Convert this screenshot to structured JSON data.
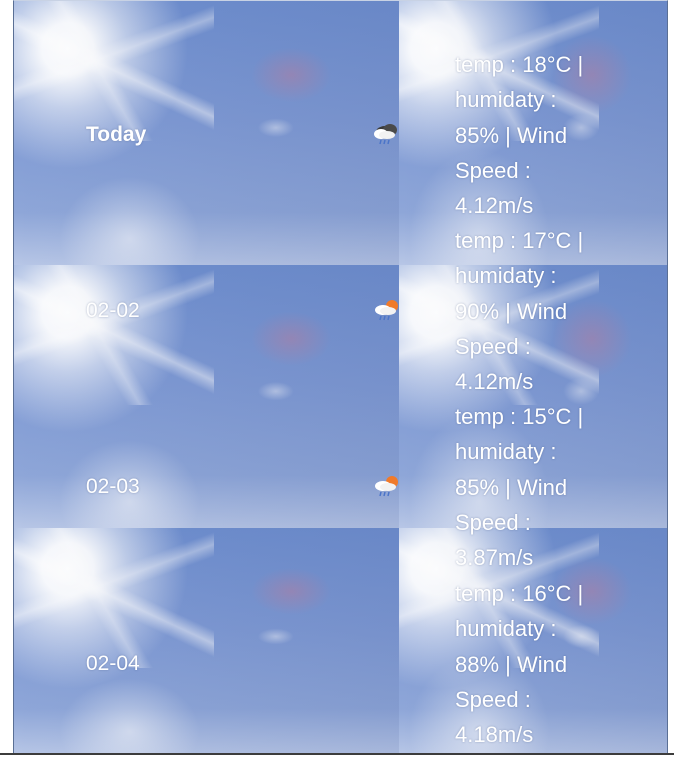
{
  "forecast": [
    {
      "day": "Today",
      "icon": "rain-cloud-icon",
      "info": "temp : 18°C | humidaty : 85% | Wind Speed : 4.12m/s"
    },
    {
      "day": "02-02",
      "icon": "sun-rain-cloud-icon",
      "info": "temp : 17°C | humidaty : 90% | Wind Speed : 4.12m/s"
    },
    {
      "day": "02-03",
      "icon": "sun-rain-cloud-icon",
      "info": "temp : 15°C | humidaty : 85% | Wind Speed : 3.87m/s"
    },
    {
      "day": "02-04",
      "icon": "none",
      "info": "temp : 16°C | humidaty : 88% | Wind Speed : 4.18m/s"
    }
  ],
  "colors": {
    "text": "#ffffff",
    "sky": "#7f9ad4",
    "border": "#5a6f95"
  }
}
